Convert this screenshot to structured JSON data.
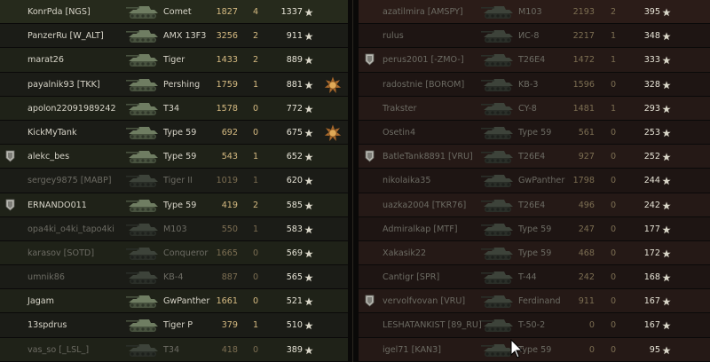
{
  "left_team": [
    {
      "player": "KonrPda [NGS]",
      "tank": "Comet",
      "damage": "1827",
      "frags": "4",
      "xp": "1337",
      "alive": true,
      "platoon": false,
      "medal": false
    },
    {
      "player": "PanzerRu [W_ALT]",
      "tank": "AMX 13F3",
      "damage": "3256",
      "frags": "2",
      "xp": "911",
      "alive": true,
      "platoon": false,
      "medal": false
    },
    {
      "player": "marat26",
      "tank": "Tiger",
      "damage": "1433",
      "frags": "2",
      "xp": "889",
      "alive": true,
      "platoon": false,
      "medal": false
    },
    {
      "player": "payalnik93 [TKK]",
      "tank": "Pershing",
      "damage": "1759",
      "frags": "1",
      "xp": "881",
      "alive": true,
      "platoon": false,
      "medal": true
    },
    {
      "player": "apolon22091989242",
      "tank": "T34",
      "damage": "1578",
      "frags": "0",
      "xp": "772",
      "alive": true,
      "platoon": false,
      "medal": false
    },
    {
      "player": "KickMyTank",
      "tank": "Type 59",
      "damage": "692",
      "frags": "0",
      "xp": "675",
      "alive": true,
      "platoon": false,
      "medal": true
    },
    {
      "player": "alekc_bes",
      "tank": "Type 59",
      "damage": "543",
      "frags": "1",
      "xp": "652",
      "alive": true,
      "platoon": true,
      "medal": false
    },
    {
      "player": "sergey9875 [MABP]",
      "tank": "Tiger II",
      "damage": "1019",
      "frags": "1",
      "xp": "620",
      "alive": false,
      "platoon": false,
      "medal": false
    },
    {
      "player": "ERNANDO011",
      "tank": "Type 59",
      "damage": "419",
      "frags": "2",
      "xp": "585",
      "alive": true,
      "platoon": true,
      "medal": false
    },
    {
      "player": "opa4ki_o4ki_tapo4ki",
      "tank": "M103",
      "damage": "550",
      "frags": "1",
      "xp": "583",
      "alive": false,
      "platoon": false,
      "medal": false
    },
    {
      "player": "karasov [SOTD]",
      "tank": "Conqueror",
      "damage": "1665",
      "frags": "0",
      "xp": "569",
      "alive": false,
      "platoon": false,
      "medal": false
    },
    {
      "player": "umnik86",
      "tank": "KB-4",
      "damage": "887",
      "frags": "0",
      "xp": "565",
      "alive": false,
      "platoon": false,
      "medal": false
    },
    {
      "player": "Jagam",
      "tank": "GwPanther",
      "damage": "1661",
      "frags": "0",
      "xp": "521",
      "alive": true,
      "platoon": false,
      "medal": false
    },
    {
      "player": "13spdrus",
      "tank": "Tiger P",
      "damage": "379",
      "frags": "1",
      "xp": "510",
      "alive": true,
      "platoon": false,
      "medal": false
    },
    {
      "player": "vas_so [_LSL_]",
      "tank": "T34",
      "damage": "418",
      "frags": "0",
      "xp": "389",
      "alive": false,
      "platoon": false,
      "medal": false
    }
  ],
  "right_team": [
    {
      "player": "azatilmira [AMSPY]",
      "tank": "M103",
      "damage": "2193",
      "frags": "2",
      "xp": "395",
      "alive": false,
      "platoon": false
    },
    {
      "player": "rulus",
      "tank": "ИС-8",
      "damage": "2217",
      "frags": "1",
      "xp": "348",
      "alive": false,
      "platoon": false
    },
    {
      "player": "perus2001 [-ZMO-]",
      "tank": "T26E4",
      "damage": "1472",
      "frags": "1",
      "xp": "333",
      "alive": false,
      "platoon": true
    },
    {
      "player": "radostnie [BOROM]",
      "tank": "KB-3",
      "damage": "1596",
      "frags": "0",
      "xp": "328",
      "alive": false,
      "platoon": false
    },
    {
      "player": "Trakster",
      "tank": "CY-8",
      "damage": "1481",
      "frags": "1",
      "xp": "293",
      "alive": false,
      "platoon": false
    },
    {
      "player": "Osetin4",
      "tank": "Type 59",
      "damage": "561",
      "frags": "0",
      "xp": "253",
      "alive": false,
      "platoon": false
    },
    {
      "player": "BatleTank8891 [VRU]",
      "tank": "T26E4",
      "damage": "927",
      "frags": "0",
      "xp": "252",
      "alive": false,
      "platoon": true
    },
    {
      "player": "nikolaika35",
      "tank": "GwPanther",
      "damage": "1798",
      "frags": "0",
      "xp": "244",
      "alive": false,
      "platoon": false
    },
    {
      "player": "uazka2004 [TKR76]",
      "tank": "T26E4",
      "damage": "496",
      "frags": "0",
      "xp": "242",
      "alive": false,
      "platoon": false
    },
    {
      "player": "Admiralkap [MTF]",
      "tank": "Type 59",
      "damage": "247",
      "frags": "0",
      "xp": "177",
      "alive": false,
      "platoon": false
    },
    {
      "player": "Xakasik22",
      "tank": "Type 59",
      "damage": "468",
      "frags": "0",
      "xp": "172",
      "alive": false,
      "platoon": false
    },
    {
      "player": "Cantigr [SPR]",
      "tank": "T-44",
      "damage": "242",
      "frags": "0",
      "xp": "168",
      "alive": false,
      "platoon": false
    },
    {
      "player": "vervolfvovan [VRU]",
      "tank": "Ferdinand",
      "damage": "911",
      "frags": "0",
      "xp": "167",
      "alive": false,
      "platoon": true
    },
    {
      "player": "LESHATANKIST [89_RU]",
      "tank": "T-50-2",
      "damage": "0",
      "frags": "0",
      "xp": "167",
      "alive": false,
      "platoon": false
    },
    {
      "player": "igel71 [KAN3]",
      "tank": "Type 59",
      "damage": "0",
      "frags": "0",
      "xp": "95",
      "alive": false,
      "platoon": false
    }
  ],
  "icons": {
    "xp": "star-icon",
    "platoon": "platoon-icon",
    "medal": "medal-icon",
    "tank": "tank-icon"
  },
  "colors": {
    "alive_text": "#d7d4c8",
    "dead_text": "#6c6b63",
    "number": "#d6bb82",
    "row_green": "#1f2218",
    "row_red": "#251916"
  }
}
